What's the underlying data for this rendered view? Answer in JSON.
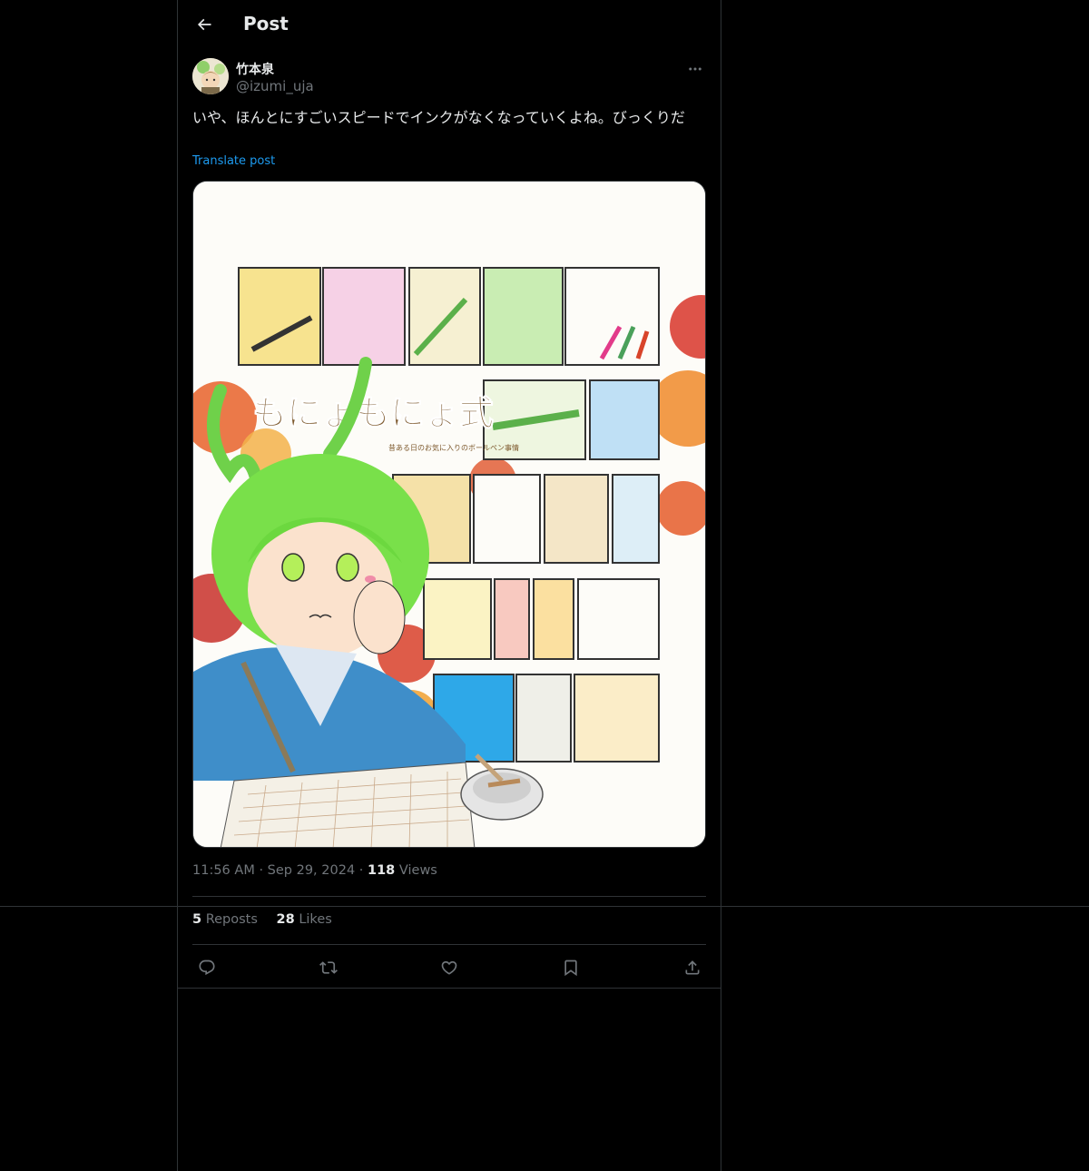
{
  "header": {
    "title": "Post"
  },
  "post": {
    "author": {
      "display_name": "竹本泉",
      "handle": "@izumi_uja"
    },
    "text": "いや、ほんとにすごいスピードでインクがなくなっていくよね。びっくりだ",
    "translate_label": "Translate post",
    "time": "11:56 AM",
    "date": "Sep 29, 2024",
    "views_count": "118",
    "views_label": "Views",
    "separator": "·"
  },
  "stats": {
    "reposts_count": "5",
    "reposts_label": "Reposts",
    "likes_count": "28",
    "likes_label": "Likes"
  },
  "media": {
    "comic_title": "もにょもにょ式",
    "comic_subtitle": "昔ある日のお気に入りのボールペン事情"
  },
  "icons": {
    "back": "arrow-left-icon",
    "more": "more-horizontal-icon",
    "reply": "reply-icon",
    "repost": "repost-icon",
    "like": "heart-icon",
    "bookmark": "bookmark-icon",
    "share": "share-icon"
  },
  "colors": {
    "background": "#000000",
    "text_primary": "#e7e9ea",
    "text_secondary": "#71767b",
    "border": "#2f3336",
    "link": "#1d9bf0"
  }
}
